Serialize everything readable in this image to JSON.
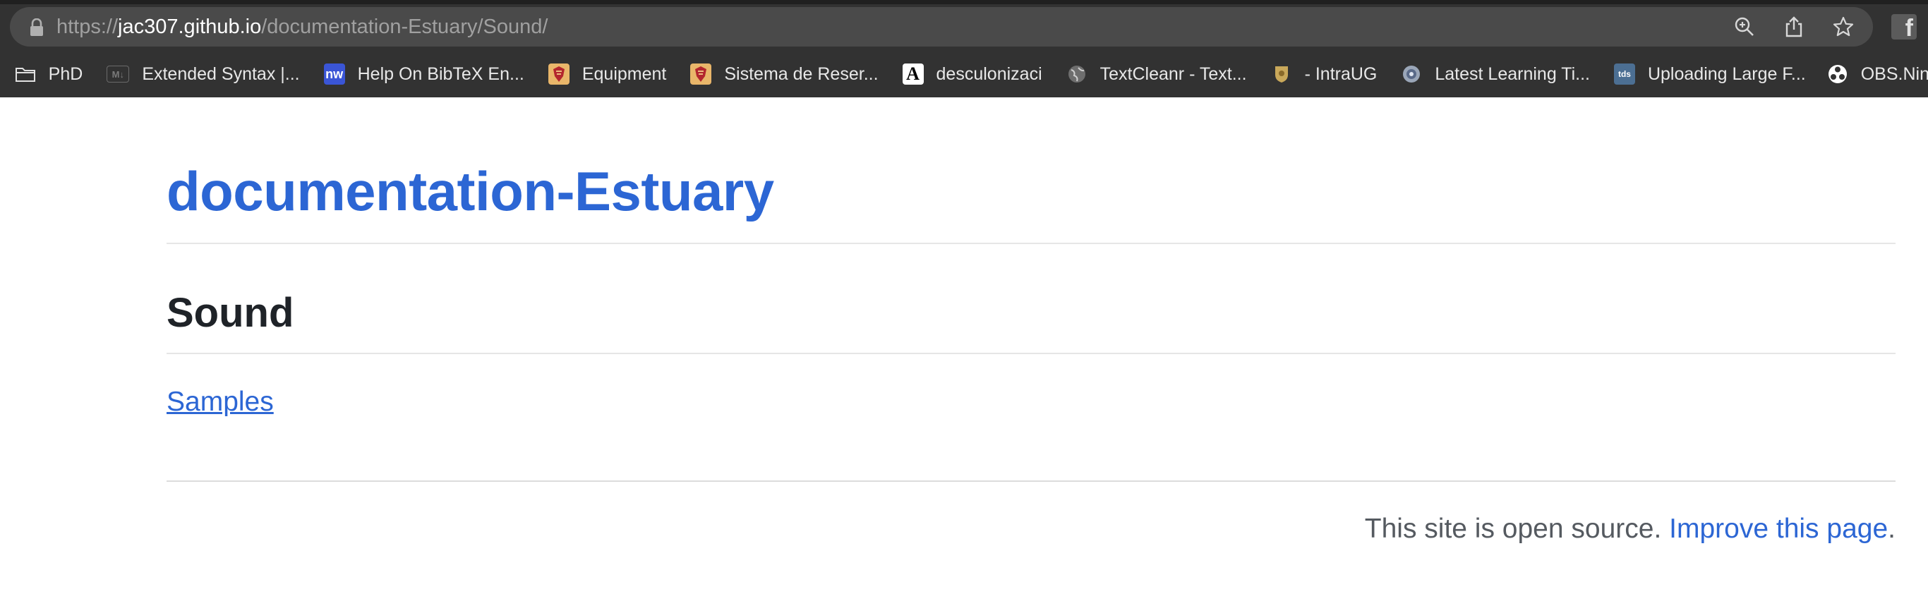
{
  "browser": {
    "url_prefix": "https://",
    "url_host": "jac307.github.io",
    "url_path": "/documentation-Estuary/Sound/",
    "fb_extension": "f",
    "bookmarks": [
      {
        "label": "PhD",
        "icon": "folder-icon"
      },
      {
        "label": "Extended Syntax |...",
        "icon": "markdown-icon",
        "icon_text": "M↓"
      },
      {
        "label": "Help On BibTeX En...",
        "icon": "nw-icon",
        "icon_text": "nw"
      },
      {
        "label": "Equipment",
        "icon": "crest-icon"
      },
      {
        "label": "Sistema de Reser...",
        "icon": "crest-icon"
      },
      {
        "label": "desculonizaci",
        "icon": "letter-a-icon",
        "icon_text": "A"
      },
      {
        "label": "TextCleanr - Text...",
        "icon": "globe-icon"
      },
      {
        "label": "- IntraUG",
        "icon": "shield-icon"
      },
      {
        "label": "Latest Learning Ti...",
        "icon": "disc-icon"
      },
      {
        "label": "Uploading Large F...",
        "icon": "tds-icon",
        "icon_text": "tds"
      },
      {
        "label": "OBS.Nin",
        "icon": "obs-icon"
      }
    ]
  },
  "page": {
    "site_title": "documentation-Estuary",
    "heading": "Sound",
    "link_samples": "Samples",
    "footer_text": "This site is open source. ",
    "footer_link": "Improve this page",
    "footer_end": "."
  },
  "colors": {
    "link": "#2c66d4",
    "heading": "#1f2328",
    "chrome_bg": "#323232",
    "urlbar_bg": "#4a4a4a"
  }
}
